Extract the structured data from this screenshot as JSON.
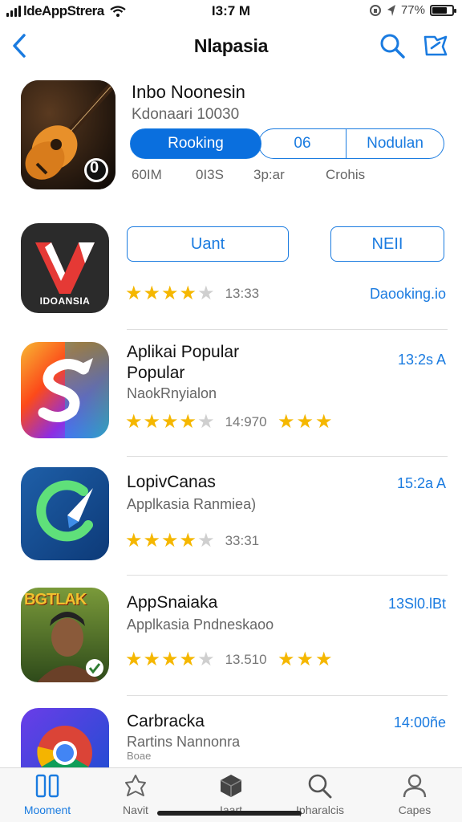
{
  "status_bar": {
    "carrier": "ldeAppStrera",
    "time": "I3:7 M",
    "battery_text": "77%",
    "battery_level": 0.77
  },
  "nav": {
    "title": "Nlapasia",
    "back_icon": "chevron-left-icon",
    "search_icon": "search-icon",
    "share_icon": "share-icon"
  },
  "featured": {
    "name": "Inbo Noonesin",
    "subtitle": "Kdonaari 10030",
    "segments": [
      "Rooking",
      "06",
      "Nodulan"
    ],
    "stats": [
      "60IM",
      "0I3S",
      "3p:ar",
      "Crohis"
    ],
    "icon_badge": "0"
  },
  "rows": [
    {
      "icon_label": "IDOANSIA",
      "button_left": "Uant",
      "button_right": "NEII",
      "rating": 4,
      "rating_text": "13:33",
      "right_text": "Daooking.io"
    },
    {
      "title_lines": [
        "Aplikai Popular",
        "Popular"
      ],
      "subtitle": "NaokRnyialon",
      "rating": 4,
      "rating_text": "14:970",
      "extra_stars": 3,
      "right_text": "13:2s A"
    },
    {
      "title": "LopivCanas",
      "subtitle": "Applkasia Ranmiea)",
      "rating": 4,
      "rating_text": "33:31",
      "right_text": "15:2a A"
    },
    {
      "icon_label": "BGTLAK",
      "title": "AppSnaiaka",
      "subtitle": "Applkasia Pndneskaoo",
      "rating": 4,
      "rating_text": "13.510",
      "extra_stars": 3,
      "right_text": "13Sl0.lBt"
    },
    {
      "title": "Carbracka",
      "subtitle": "Rartins Nannonra",
      "subtitle2": "Boae",
      "right_text": "14:00ñe"
    }
  ],
  "tabbar": {
    "items": [
      {
        "label": "Mooment",
        "icon": "apps-icon"
      },
      {
        "label": "Navit",
        "icon": "games-icon"
      },
      {
        "label": "Iaart",
        "icon": "arcade-icon"
      },
      {
        "label": "Ipharalcis",
        "icon": "search-icon"
      },
      {
        "label": "Capes",
        "icon": "profile-icon"
      }
    ],
    "active_index": 0
  },
  "colors": {
    "accent": "#1a7be0",
    "star": "#f5b700",
    "star_off": "#cfcfcf"
  }
}
